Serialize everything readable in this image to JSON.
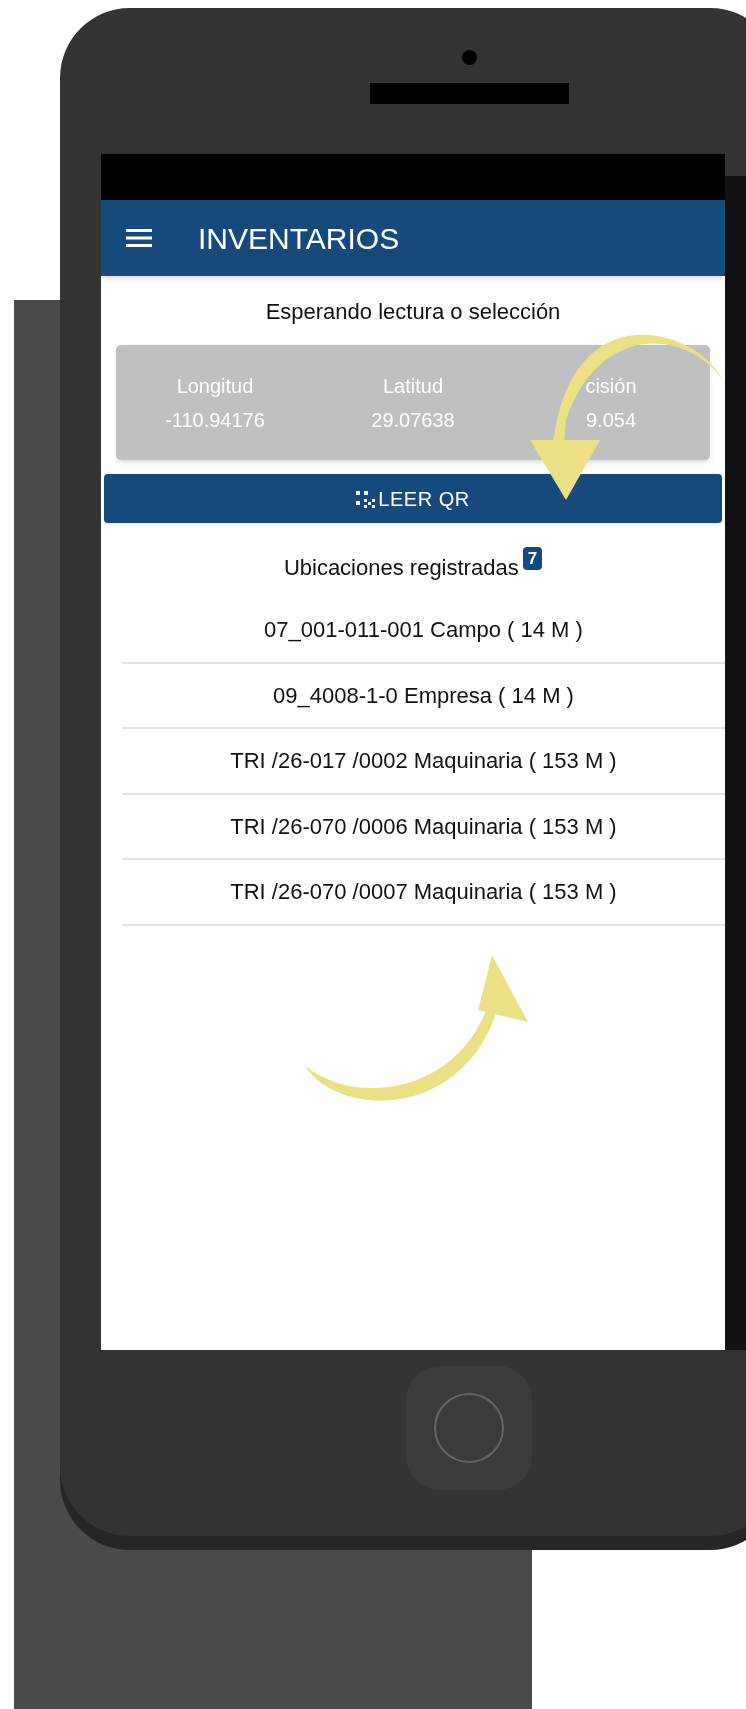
{
  "app_bar": {
    "title": "INVENTARIOS"
  },
  "status": "Esperando lectura o selección",
  "coordinates": [
    {
      "label": "Longitud",
      "value": "-110.94176"
    },
    {
      "label": "Latitud",
      "value": "29.07638"
    },
    {
      "label": "cisión",
      "value": "9.054"
    }
  ],
  "scan_button": {
    "label": "LEER QR"
  },
  "locations": {
    "title": "Ubicaciones registradas",
    "count": "7",
    "items": [
      "07_001-011-001 Campo ( 14 M )",
      "09_4008-1-0 Empresa ( 14 M )",
      "TRI /26-017 /0002 Maquinaria ( 153 M )",
      "TRI /26-070 /0006 Maquinaria ( 153 M )",
      "TRI /26-070 /0007 Maquinaria ( 153 M )"
    ]
  }
}
